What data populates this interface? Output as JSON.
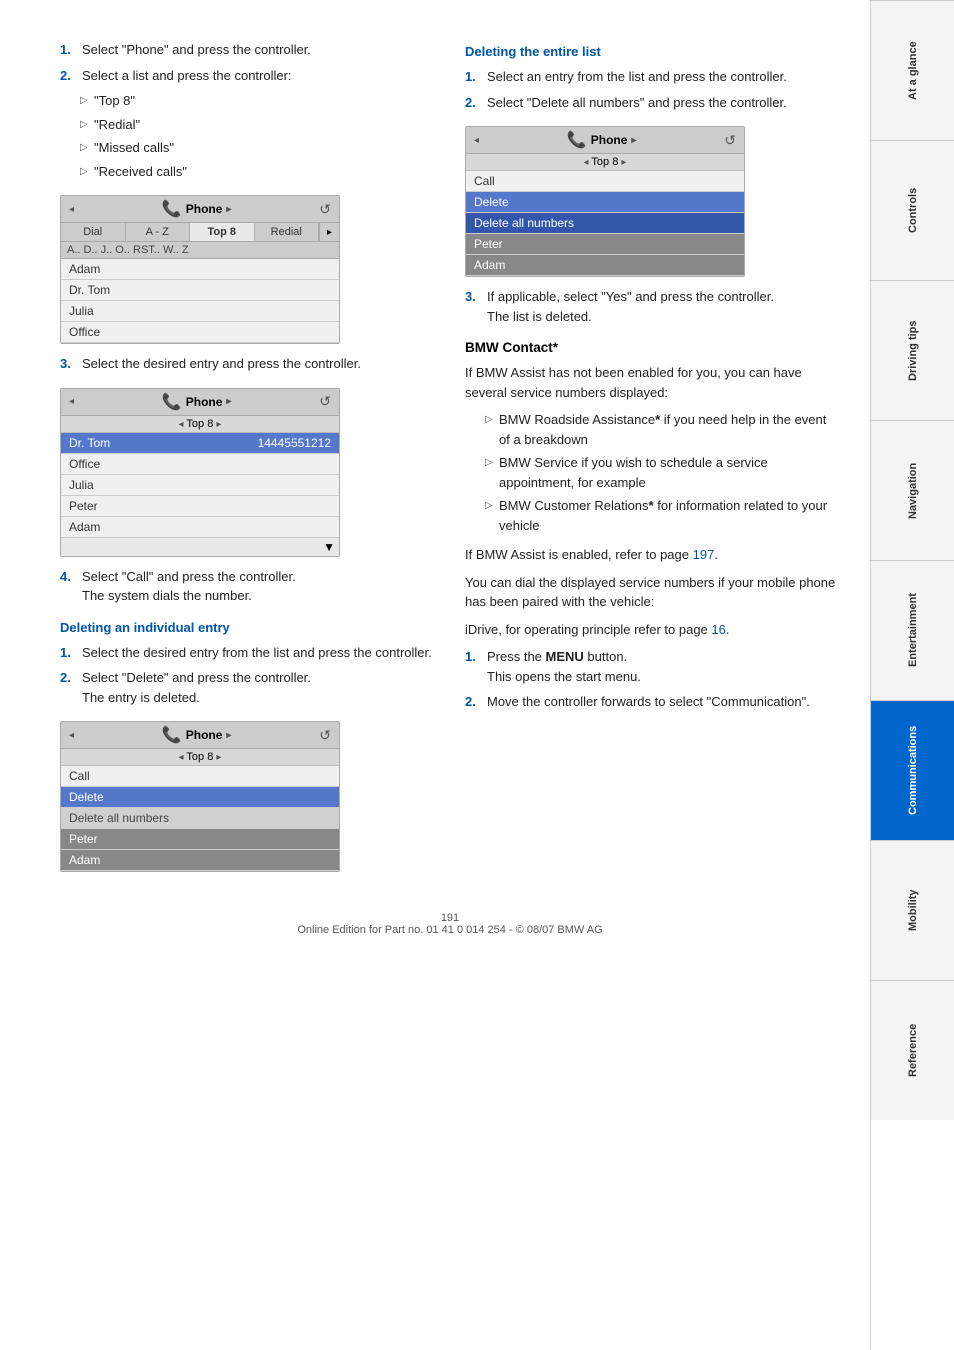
{
  "page": {
    "number": "191",
    "footer": "Online Edition for Part no. 01 41 0 014 254 - © 08/07 BMW AG"
  },
  "sidebar": {
    "tabs": [
      {
        "id": "at-a-glance",
        "label": "At a glance",
        "active": false
      },
      {
        "id": "controls",
        "label": "Controls",
        "active": false
      },
      {
        "id": "driving-tips",
        "label": "Driving tips",
        "active": false
      },
      {
        "id": "navigation",
        "label": "Navigation",
        "active": false
      },
      {
        "id": "entertainment",
        "label": "Entertainment",
        "active": false
      },
      {
        "id": "communications",
        "label": "Communications",
        "active": true
      },
      {
        "id": "mobility",
        "label": "Mobility",
        "active": false
      },
      {
        "id": "reference",
        "label": "Reference",
        "active": false
      }
    ]
  },
  "left_col": {
    "intro_steps": [
      {
        "num": "1.",
        "text": "Select \"Phone\" and press the controller."
      },
      {
        "num": "2.",
        "text": "Select a list and press the controller:"
      }
    ],
    "list_items": [
      "\"Top 8\"",
      "\"Redial\"",
      "\"Missed calls\"",
      "\"Received calls\""
    ],
    "step3": {
      "num": "3.",
      "text": "Select the desired entry and press the controller."
    },
    "phone_ui_1": {
      "top_title": "Phone",
      "sub_title": "Top 8",
      "tabs": [
        "Dial",
        "A - Z",
        "Top 8",
        "Redial"
      ],
      "active_tab": "Top 8",
      "alpha": "A..  D..  J..  O..  RST..  W..  Z",
      "rows": [
        {
          "text": "Adam",
          "value": "",
          "style": "normal"
        },
        {
          "text": "Dr. Tom",
          "value": "",
          "style": "normal"
        },
        {
          "text": "Julia",
          "value": "",
          "style": "normal"
        },
        {
          "text": "Office",
          "value": "",
          "style": "normal"
        }
      ]
    },
    "phone_ui_2": {
      "top_title": "Phone",
      "sub_title": "Top 8",
      "rows": [
        {
          "text": "Dr. Tom",
          "value": "14445551212",
          "style": "highlighted"
        },
        {
          "text": "Office",
          "value": "",
          "style": "normal"
        },
        {
          "text": "Julia",
          "value": "",
          "style": "normal"
        },
        {
          "text": "Peter",
          "value": "",
          "style": "normal"
        },
        {
          "text": "Adam",
          "value": "",
          "style": "normal"
        }
      ]
    },
    "step4": {
      "num": "4.",
      "text": "Select \"Call\" and press the controller.\nThe system dials the number."
    },
    "deleting_individual": {
      "heading": "Deleting an individual entry",
      "steps": [
        {
          "num": "1.",
          "text": "Select the desired entry from the list and press the controller."
        },
        {
          "num": "2.",
          "text": "Select \"Delete\" and press the controller.\nThe entry is deleted."
        }
      ]
    },
    "phone_ui_3": {
      "top_title": "Phone",
      "sub_title": "Top 8",
      "rows": [
        {
          "text": "Call",
          "style": "normal"
        },
        {
          "text": "Delete",
          "style": "highlighted"
        },
        {
          "text": "Delete all numbers",
          "style": "light"
        },
        {
          "text": "Peter",
          "style": "dark"
        },
        {
          "text": "Adam",
          "style": "dark"
        }
      ]
    }
  },
  "right_col": {
    "deleting_entire": {
      "heading": "Deleting the entire list",
      "steps": [
        {
          "num": "1.",
          "text": "Select an entry from the list and press the controller."
        },
        {
          "num": "2.",
          "text": "Select \"Delete all numbers\" and press the controller."
        }
      ]
    },
    "phone_ui_4": {
      "top_title": "Phone",
      "sub_title": "Top 8",
      "rows": [
        {
          "text": "Call",
          "style": "normal"
        },
        {
          "text": "Delete",
          "style": "highlighted"
        },
        {
          "text": "Delete all numbers",
          "style": "highlighted2"
        },
        {
          "text": "Peter",
          "style": "dark"
        },
        {
          "text": "Adam",
          "style": "dark"
        }
      ]
    },
    "step3": {
      "num": "3.",
      "text": "If applicable, select \"Yes\" and press the controller.\nThe list is deleted."
    },
    "bmw_contact": {
      "heading": "BMW Contact*",
      "intro": "If BMW Assist has not been enabled for you, you can have several service numbers displayed:",
      "items": [
        "BMW Roadside Assistance* if you need help in the event of a breakdown",
        "BMW Service if you wish to schedule a service appointment, for example",
        "BMW Customer Relations* for information related to your vehicle"
      ],
      "para1": "If BMW Assist is enabled, refer to page 197.",
      "para2": "You can dial the displayed service numbers if your mobile phone has been paired with the vehicle:",
      "para3": "iDrive, for operating principle refer to page 16.",
      "steps": [
        {
          "num": "1.",
          "text": "Press the MENU button.\nThis opens the start menu."
        },
        {
          "num": "2.",
          "text": "Move the controller forwards to select \"Communication\"."
        }
      ],
      "page_ref_1": "197",
      "page_ref_2": "16"
    }
  }
}
